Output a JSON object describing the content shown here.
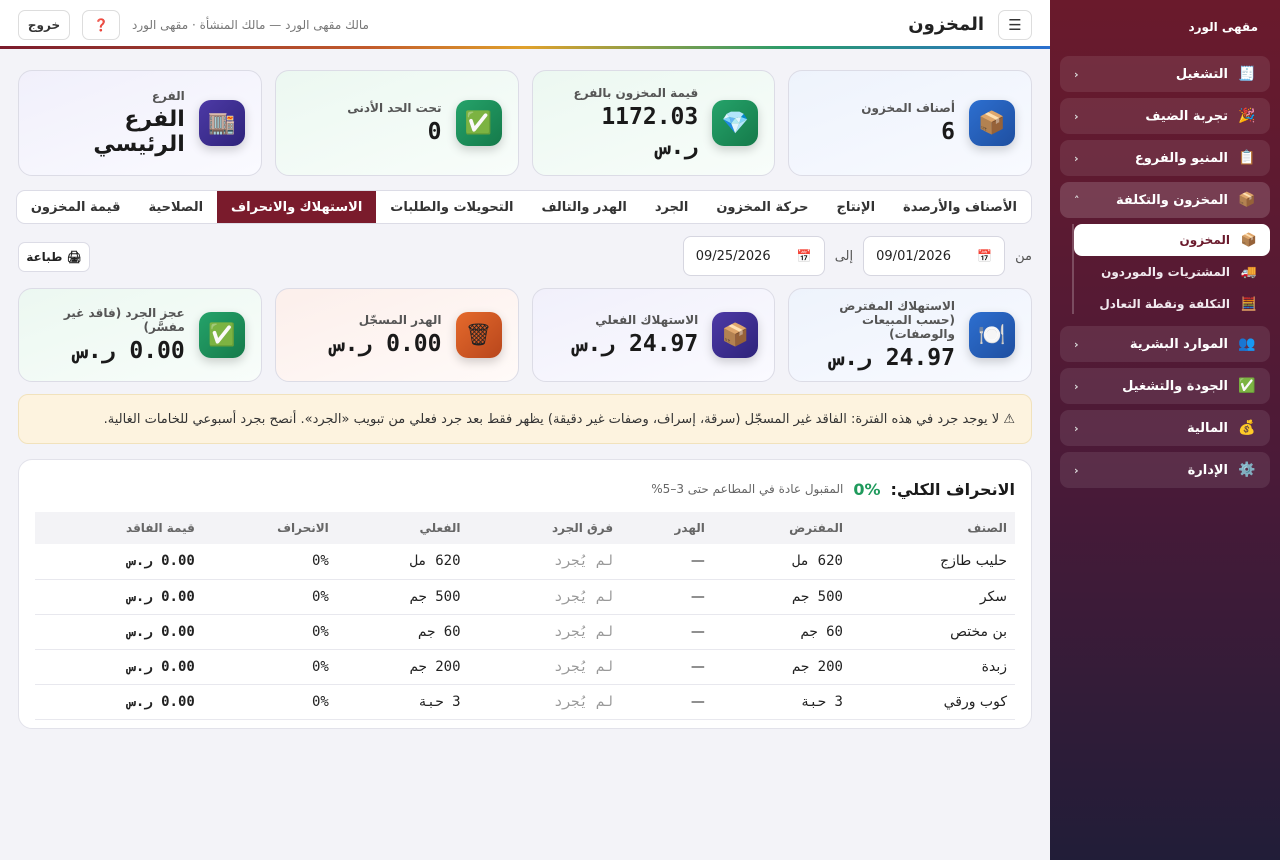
{
  "sidebar": {
    "brand": "مقهى الورد",
    "groups": [
      {
        "label": "التشغيل",
        "icon": "🧾",
        "chevron": "‹"
      },
      {
        "label": "تجربة الضيف",
        "icon": "🎉",
        "chevron": "‹"
      },
      {
        "label": "المنيو والفروع",
        "icon": "📋",
        "chevron": "‹"
      },
      {
        "label": "المخزون والتكلفة",
        "icon": "📦",
        "chevron": "˄"
      },
      {
        "label": "الموارد البشرية",
        "icon": "👥",
        "chevron": "‹"
      },
      {
        "label": "الجودة والتشغيل",
        "icon": "✅",
        "chevron": "‹"
      },
      {
        "label": "المالية",
        "icon": "💰",
        "chevron": "‹"
      },
      {
        "label": "الإدارة",
        "icon": "⚙️",
        "chevron": "‹"
      }
    ],
    "sub_items": [
      {
        "label": "المخزون",
        "icon": "📦"
      },
      {
        "label": "المشتريات والموردون",
        "icon": "🚚"
      },
      {
        "label": "التكلفة ونقطة التعادل",
        "icon": "🧮"
      }
    ]
  },
  "header": {
    "menu_icon": "☰",
    "title": "المخزون",
    "user_line": "مالك مقهى الورد — مالك المنشأة · مقهى الورد",
    "help_label": "❓",
    "logout_label": "خروج"
  },
  "stats": [
    {
      "label": "أصناف المخزون",
      "value": "6",
      "icon": "📦"
    },
    {
      "label": "قيمة المخزون بالفرع",
      "value": "1172.03",
      "unit": "ر.س",
      "icon": "💎"
    },
    {
      "label": "تحت الحد الأدنى",
      "value": "0",
      "icon": "✅"
    },
    {
      "label": "الفرع",
      "value": "الفرع الرئيسي",
      "icon": "🏬"
    }
  ],
  "tabs": [
    "الأصناف والأرصدة",
    "الإنتاج",
    "حركة المخزون",
    "الجرد",
    "الهدر والتالف",
    "التحويلات والطلبات",
    "الاستهلاك والانحراف",
    "الصلاحية",
    "قيمة المخزون"
  ],
  "filters": {
    "from_label": "من",
    "from_value": "09/01/2026",
    "to_label": "إلى",
    "to_value": "09/25/2026",
    "calendar_icon": "📅",
    "print_label": "🖨 طباعة"
  },
  "stats2": [
    {
      "label": "الاستهلاك المفترض (حسب المبيعات والوصفات)",
      "value": "24.97 ر.س",
      "icon": "🍽️"
    },
    {
      "label": "الاستهلاك الفعلي",
      "value": "24.97 ر.س",
      "icon": "📦"
    },
    {
      "label": "الهدر المسجّل",
      "value": "0.00 ر.س",
      "icon": "🗑"
    },
    {
      "label": "عجز الجرد (فاقد غير مفسَّر)",
      "value": "0.00 ر.س",
      "icon": "✅"
    }
  ],
  "alert": "⚠ لا يوجد جرد في هذه الفترة: الفاقد غير المسجّل (سرقة، إسراف، وصفات غير دقيقة) يظهر فقط بعد جرد فعلي من تبويب «الجرد». أنصح بجرد أسبوعي للخامات الغالية.",
  "variance": {
    "title": "الانحراف الكلي:",
    "percent": "0%",
    "subtitle": "المقبول عادة في المطاعم حتى 3–5%",
    "columns": [
      "الصنف",
      "المفترض",
      "الهدر",
      "فرق الجرد",
      "الفعلي",
      "الانحراف",
      "قيمة الفاقد"
    ],
    "rows": [
      [
        "حليب طازج",
        "620 مل",
        "—",
        "لم يُجرد",
        "620 مل",
        "0%",
        "0.00 ر.س"
      ],
      [
        "سكر",
        "500 جم",
        "—",
        "لم يُجرد",
        "500 جم",
        "0%",
        "0.00 ر.س"
      ],
      [
        "بن مختص",
        "60 جم",
        "—",
        "لم يُجرد",
        "60 جم",
        "0%",
        "0.00 ر.س"
      ],
      [
        "زبدة",
        "200 جم",
        "—",
        "لم يُجرد",
        "200 جم",
        "0%",
        "0.00 ر.س"
      ],
      [
        "كوب ورقي",
        "3 حبة",
        "—",
        "لم يُجرد",
        "3 حبة",
        "0%",
        "0.00 ر.س"
      ]
    ]
  },
  "colors": {
    "brand": "#7a1b2c",
    "ok": "#1f9a5c",
    "warn_bg": "#fdf3df"
  }
}
